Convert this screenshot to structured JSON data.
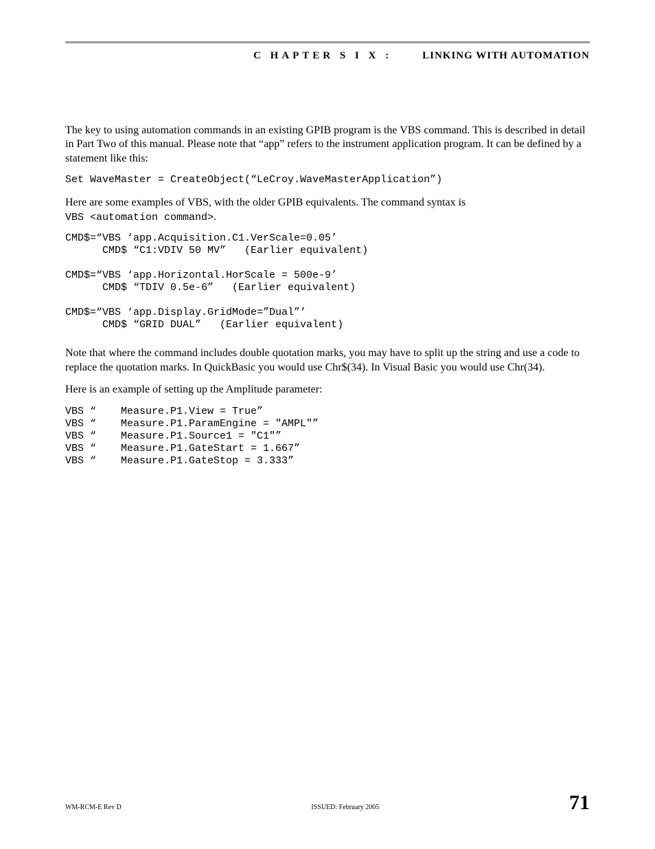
{
  "header": {
    "chapter": "C HAPTER  S I X :",
    "title": "LINKING WITH AUTOMATION"
  },
  "body": {
    "p1": "The key to using automation commands in an existing GPIB program is the VBS command. This is described in detail in Part Two of this manual. Please note that “app” refers to the instrument application program. It can be defined by a statement like this:",
    "code1": "Set WaveMaster = CreateObject(“LeCroy.WaveMasterApplication”)",
    "p2a": "Here are some examples of VBS, with the older GPIB equivalents. The command syntax is",
    "p2b": "VBS <automation command>",
    "p2c": ".",
    "code2": "CMD$=“VBS ‘app.Acquisition.C1.VerScale=0.05’\n      CMD$ “C1:VDIV 50 MV”   (Earlier equivalent)\n\nCMD$=“VBS ‘app.Horizontal.HorScale = 500e-9’\n      CMD$ “TDIV 0.5e-6”   (Earlier equivalent)\n\nCMD$=“VBS ‘app.Display.GridMode=”Dual”’\n      CMD$ “GRID DUAL”   (Earlier equivalent)",
    "p3": "Note that where the command includes double quotation marks, you may have to split up the string and use a code to replace the quotation marks. In QuickBasic you would use Chr$(34). In Visual Basic you would use Chr(34).",
    "p4": "Here is an example of setting up the Amplitude parameter:",
    "code3": "VBS “    Measure.P1.View = True”\nVBS “    Measure.P1.ParamEngine = \"AMPL\"”\nVBS “    Measure.P1.Source1 = \"C1\"”\nVBS “    Measure.P1.GateStart = 1.667”\nVBS “    Measure.P1.GateStop = 3.333”"
  },
  "footer": {
    "rev": "WM-RCM-E Rev D",
    "issued": "ISSUED: February 2005",
    "page": "71"
  }
}
